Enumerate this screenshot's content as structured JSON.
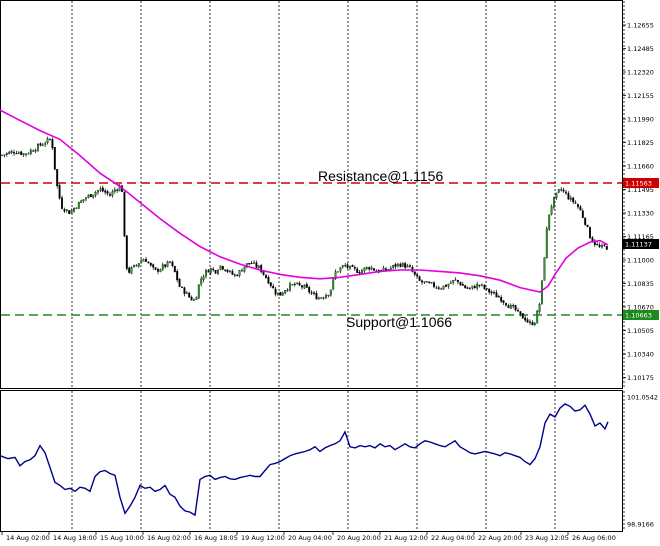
{
  "chart_data": [
    {
      "type": "candlestick",
      "title": "",
      "ylim": [
        1.10175,
        1.1282
      ],
      "y_ticks": [
        "1.12655",
        "1.12485",
        "1.12320",
        "1.12155",
        "1.11990",
        "1.11825",
        "1.11660",
        "1.11495",
        "1.11330",
        "1.11165",
        "1.11000",
        "1.10835",
        "1.10670",
        "1.10505",
        "1.10340",
        "1.10175"
      ],
      "x_ticks": [
        "14 Aug 02:00",
        "14 Aug 18:00",
        "15 Aug 10:00",
        "16 Aug 02:00",
        "16 Aug 18:05",
        "19 Aug 12:00",
        "20 Aug 04:00",
        "20 Aug 20:00",
        "21 Aug 12:00",
        "22 Aug 04:00",
        "22 Aug 20:00",
        "23 Aug 12:05",
        "26 Aug 06:00"
      ],
      "grid": "vertical dashed",
      "levels": [
        {
          "label": "Resistance@1.1156",
          "value": 1.11563,
          "tag": "1.11563",
          "color": "#cc0000"
        },
        {
          "label": "Support@1.1066",
          "value": 1.10663,
          "tag": "1.10663",
          "color": "#1e8a1e"
        }
      ],
      "last_price": {
        "value": 1.11137,
        "tag": "1.11137"
      },
      "close_path": [
        [
          0,
          1.1175
        ],
        [
          5,
          1.1176
        ],
        [
          10,
          1.1177
        ],
        [
          15,
          1.1178
        ],
        [
          20,
          1.1177
        ],
        [
          25,
          1.1176
        ],
        [
          30,
          1.1178
        ],
        [
          35,
          1.118
        ],
        [
          40,
          1.1182
        ],
        [
          45,
          1.1184
        ],
        [
          50,
          1.1186
        ],
        [
          53,
          1.118
        ],
        [
          55,
          1.1165
        ],
        [
          58,
          1.115
        ],
        [
          62,
          1.114
        ],
        [
          66,
          1.1138
        ],
        [
          70,
          1.1136
        ],
        [
          75,
          1.114
        ],
        [
          80,
          1.1143
        ],
        [
          85,
          1.1146
        ],
        [
          90,
          1.1148
        ],
        [
          95,
          1.115
        ],
        [
          100,
          1.1152
        ],
        [
          105,
          1.115
        ],
        [
          110,
          1.1148
        ],
        [
          115,
          1.1152
        ],
        [
          120,
          1.1154
        ],
        [
          123,
          1.115
        ],
        [
          125,
          1.1105
        ],
        [
          128,
          1.1095
        ],
        [
          132,
          1.1098
        ],
        [
          136,
          1.11
        ],
        [
          140,
          1.1103
        ],
        [
          145,
          1.1105
        ],
        [
          150,
          1.11
        ],
        [
          155,
          1.1096
        ],
        [
          160,
          1.1098
        ],
        [
          165,
          1.11
        ],
        [
          170,
          1.1102
        ],
        [
          175,
          1.1095
        ],
        [
          180,
          1.1085
        ],
        [
          185,
          1.1082
        ],
        [
          190,
          1.1078
        ],
        [
          195,
          1.1076
        ],
        [
          200,
          1.109
        ],
        [
          205,
          1.1095
        ],
        [
          210,
          1.1098
        ],
        [
          215,
          1.1096
        ],
        [
          220,
          1.11
        ],
        [
          225,
          1.1098
        ],
        [
          230,
          1.1095
        ],
        [
          235,
          1.1093
        ],
        [
          240,
          1.1096
        ],
        [
          245,
          1.11
        ],
        [
          250,
          1.1102
        ],
        [
          255,
          1.11
        ],
        [
          260,
          1.1098
        ],
        [
          265,
          1.1093
        ],
        [
          270,
          1.1088
        ],
        [
          275,
          1.1082
        ],
        [
          280,
          1.108
        ],
        [
          285,
          1.1084
        ],
        [
          290,
          1.1086
        ],
        [
          295,
          1.1087
        ],
        [
          300,
          1.1086
        ],
        [
          305,
          1.1085
        ],
        [
          310,
          1.1082
        ],
        [
          315,
          1.1079
        ],
        [
          320,
          1.1078
        ],
        [
          325,
          1.108
        ],
        [
          330,
          1.1082
        ],
        [
          335,
          1.1095
        ],
        [
          340,
          1.1098
        ],
        [
          345,
          1.11
        ],
        [
          350,
          1.1098
        ],
        [
          355,
          1.1097
        ],
        [
          360,
          1.1096
        ],
        [
          365,
          1.1098
        ],
        [
          370,
          1.1099
        ],
        [
          375,
          1.1097
        ],
        [
          380,
          1.1096
        ],
        [
          385,
          1.1097
        ],
        [
          390,
          1.1098
        ],
        [
          395,
          1.11
        ],
        [
          400,
          1.1101
        ],
        [
          405,
          1.11
        ],
        [
          410,
          1.1098
        ],
        [
          415,
          1.1093
        ],
        [
          420,
          1.1089
        ],
        [
          425,
          1.1088
        ],
        [
          430,
          1.1087
        ],
        [
          435,
          1.1086
        ],
        [
          440,
          1.1085
        ],
        [
          445,
          1.1086
        ],
        [
          450,
          1.1088
        ],
        [
          455,
          1.109
        ],
        [
          460,
          1.1088
        ],
        [
          465,
          1.1085
        ],
        [
          470,
          1.1084
        ],
        [
          475,
          1.1086
        ],
        [
          480,
          1.1087
        ],
        [
          485,
          1.1084
        ],
        [
          490,
          1.1082
        ],
        [
          495,
          1.108
        ],
        [
          500,
          1.1078
        ],
        [
          505,
          1.1075
        ],
        [
          510,
          1.1072
        ],
        [
          515,
          1.107
        ],
        [
          520,
          1.1066
        ],
        [
          525,
          1.1064
        ],
        [
          530,
          1.106
        ],
        [
          535,
          1.1062
        ],
        [
          540,
          1.1075
        ],
        [
          543,
          1.1095
        ],
        [
          546,
          1.112
        ],
        [
          549,
          1.1135
        ],
        [
          552,
          1.1142
        ],
        [
          555,
          1.1146
        ],
        [
          558,
          1.115
        ],
        [
          561,
          1.1152
        ],
        [
          564,
          1.115
        ],
        [
          567,
          1.1148
        ],
        [
          570,
          1.1145
        ],
        [
          575,
          1.1143
        ],
        [
          580,
          1.1138
        ],
        [
          585,
          1.113
        ],
        [
          590,
          1.112
        ],
        [
          595,
          1.1115
        ],
        [
          600,
          1.1112
        ],
        [
          605,
          1.1113
        ],
        [
          608,
          1.1112
        ]
      ],
      "ma_path": [
        [
          0,
          1.1206
        ],
        [
          20,
          1.1199
        ],
        [
          40,
          1.1192
        ],
        [
          60,
          1.1186
        ],
        [
          80,
          1.1175
        ],
        [
          100,
          1.1163
        ],
        [
          120,
          1.1154
        ],
        [
          140,
          1.1143
        ],
        [
          160,
          1.1132
        ],
        [
          180,
          1.1122
        ],
        [
          200,
          1.1113
        ],
        [
          220,
          1.1106
        ],
        [
          240,
          1.1101
        ],
        [
          260,
          1.1097
        ],
        [
          280,
          1.1094
        ],
        [
          300,
          1.1092
        ],
        [
          320,
          1.1091
        ],
        [
          340,
          1.1092
        ],
        [
          360,
          1.1094
        ],
        [
          380,
          1.1096
        ],
        [
          400,
          1.1097
        ],
        [
          420,
          1.1097
        ],
        [
          440,
          1.1096
        ],
        [
          460,
          1.1095
        ],
        [
          480,
          1.1093
        ],
        [
          500,
          1.109
        ],
        [
          520,
          1.1085
        ],
        [
          540,
          1.1082
        ],
        [
          548,
          1.1086
        ],
        [
          556,
          1.1095
        ],
        [
          566,
          1.1105
        ],
        [
          578,
          1.1112
        ],
        [
          590,
          1.1116
        ],
        [
          600,
          1.1117
        ],
        [
          608,
          1.1114
        ]
      ]
    },
    {
      "type": "line",
      "title": "",
      "ylim": [
        98.9166,
        101.0542
      ],
      "y_ticks": [
        "101.0542",
        "98.9166"
      ],
      "series": [
        {
          "color": "#00008b",
          "points": [
            [
              0,
              100.05
            ],
            [
              8,
              100.0
            ],
            [
              15,
              100.02
            ],
            [
              20,
              99.88
            ],
            [
              25,
              99.95
            ],
            [
              30,
              99.98
            ],
            [
              35,
              100.05
            ],
            [
              40,
              100.22
            ],
            [
              45,
              100.1
            ],
            [
              50,
              99.85
            ],
            [
              55,
              99.6
            ],
            [
              60,
              99.55
            ],
            [
              65,
              99.48
            ],
            [
              70,
              99.5
            ],
            [
              75,
              99.45
            ],
            [
              80,
              99.52
            ],
            [
              85,
              99.5
            ],
            [
              90,
              99.45
            ],
            [
              95,
              99.7
            ],
            [
              100,
              99.78
            ],
            [
              105,
              99.8
            ],
            [
              110,
              99.75
            ],
            [
              115,
              99.72
            ],
            [
              120,
              99.35
            ],
            [
              125,
              99.08
            ],
            [
              130,
              99.2
            ],
            [
              135,
              99.35
            ],
            [
              140,
              99.55
            ],
            [
              145,
              99.5
            ],
            [
              150,
              99.52
            ],
            [
              155,
              99.45
            ],
            [
              160,
              99.48
            ],
            [
              165,
              99.55
            ],
            [
              170,
              99.4
            ],
            [
              175,
              99.35
            ],
            [
              180,
              99.2
            ],
            [
              185,
              99.12
            ],
            [
              190,
              99.1
            ],
            [
              195,
              99.05
            ],
            [
              200,
              99.65
            ],
            [
              205,
              99.7
            ],
            [
              210,
              99.72
            ],
            [
              215,
              99.65
            ],
            [
              220,
              99.68
            ],
            [
              225,
              99.7
            ],
            [
              230,
              99.66
            ],
            [
              235,
              99.65
            ],
            [
              240,
              99.68
            ],
            [
              245,
              99.7
            ],
            [
              250,
              99.72
            ],
            [
              255,
              99.7
            ],
            [
              260,
              99.7
            ],
            [
              265,
              99.8
            ],
            [
              270,
              99.9
            ],
            [
              275,
              99.92
            ],
            [
              280,
              99.95
            ],
            [
              285,
              100.0
            ],
            [
              290,
              100.05
            ],
            [
              295,
              100.08
            ],
            [
              300,
              100.1
            ],
            [
              305,
              100.12
            ],
            [
              310,
              100.15
            ],
            [
              315,
              100.2
            ],
            [
              320,
              100.12
            ],
            [
              325,
              100.18
            ],
            [
              330,
              100.22
            ],
            [
              335,
              100.25
            ],
            [
              340,
              100.3
            ],
            [
              345,
              100.45
            ],
            [
              350,
              100.2
            ],
            [
              355,
              100.18
            ],
            [
              360,
              100.22
            ],
            [
              365,
              100.2
            ],
            [
              370,
              100.22
            ],
            [
              375,
              100.18
            ],
            [
              380,
              100.25
            ],
            [
              385,
              100.2
            ],
            [
              390,
              100.22
            ],
            [
              395,
              100.15
            ],
            [
              400,
              100.2
            ],
            [
              405,
              100.25
            ],
            [
              410,
              100.2
            ],
            [
              415,
              100.18
            ],
            [
              420,
              100.25
            ],
            [
              425,
              100.3
            ],
            [
              430,
              100.28
            ],
            [
              435,
              100.25
            ],
            [
              440,
              100.22
            ],
            [
              445,
              100.2
            ],
            [
              450,
              100.25
            ],
            [
              455,
              100.3
            ],
            [
              460,
              100.2
            ],
            [
              465,
              100.15
            ],
            [
              470,
              100.1
            ],
            [
              475,
              100.08
            ],
            [
              480,
              100.1
            ],
            [
              485,
              100.12
            ],
            [
              490,
              100.1
            ],
            [
              495,
              100.08
            ],
            [
              500,
              100.05
            ],
            [
              505,
              100.1
            ],
            [
              510,
              100.08
            ],
            [
              515,
              100.05
            ],
            [
              520,
              100.02
            ],
            [
              525,
              99.95
            ],
            [
              530,
              99.9
            ],
            [
              535,
              100.0
            ],
            [
              540,
              100.2
            ],
            [
              545,
              100.6
            ],
            [
              550,
              100.75
            ],
            [
              555,
              100.7
            ],
            [
              560,
              100.85
            ],
            [
              565,
              100.92
            ],
            [
              570,
              100.88
            ],
            [
              575,
              100.8
            ],
            [
              580,
              100.82
            ],
            [
              585,
              100.9
            ],
            [
              590,
              100.75
            ],
            [
              595,
              100.55
            ],
            [
              600,
              100.6
            ],
            [
              605,
              100.5
            ],
            [
              608,
              100.62
            ]
          ]
        }
      ]
    }
  ]
}
